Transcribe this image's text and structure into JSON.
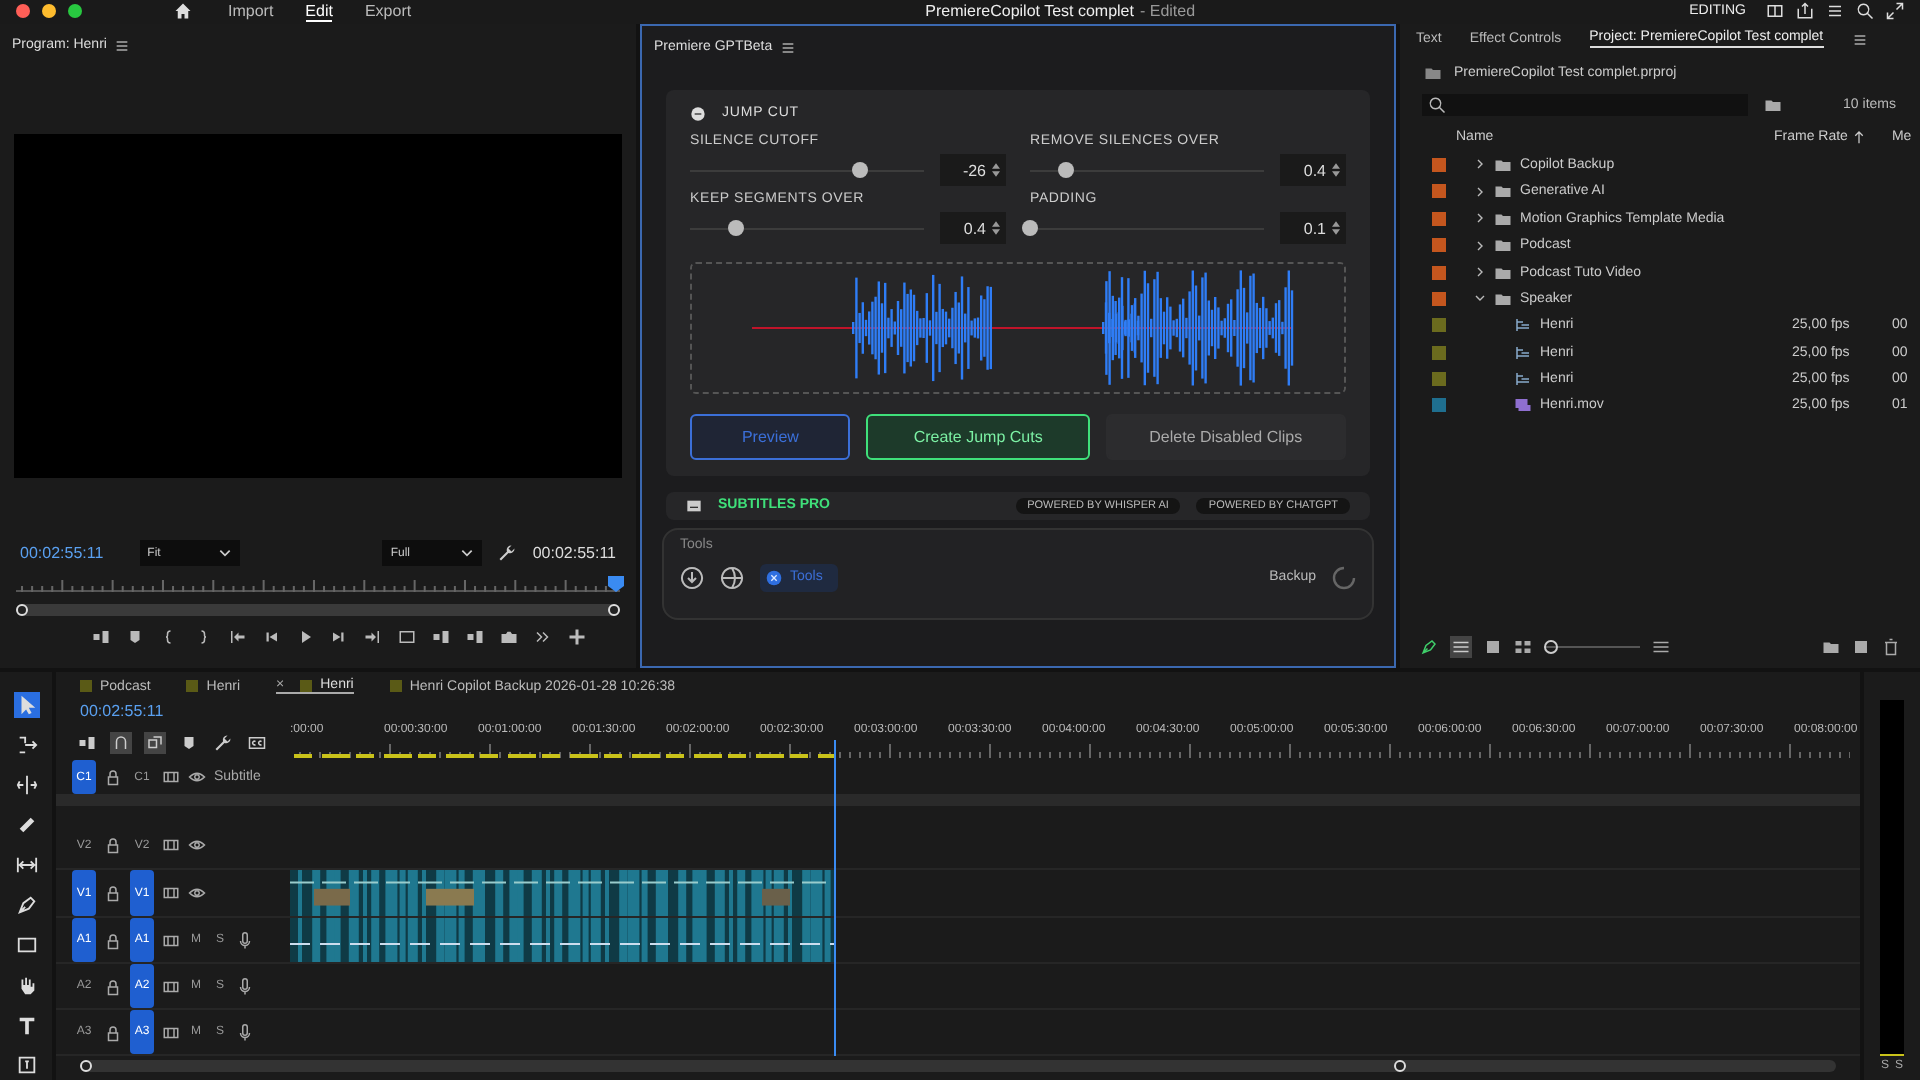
{
  "topbar": {
    "nav": [
      {
        "label": "Import",
        "selected": false
      },
      {
        "label": "Edit",
        "selected": true
      },
      {
        "label": "Export",
        "selected": false
      }
    ],
    "title": "PremiereCopilot Test complet",
    "status": "- Edited",
    "workspace": "EDITING"
  },
  "program": {
    "title": "Program: Henri",
    "timecode": "00:02:55:11",
    "zoom": "Fit",
    "quality": "Full",
    "duration": "00:02:55:11"
  },
  "plugin": {
    "title": "Premiere GPTBeta",
    "section": "JUMP CUT",
    "controls": [
      {
        "label": "SILENCE CUTOFF",
        "value": "-26",
        "level": 0.73
      },
      {
        "label": "REMOVE SILENCES OVER",
        "value": "0.4",
        "level": 0.15
      },
      {
        "label": "KEEP SEGMENTS OVER",
        "value": "0.4",
        "level": 0.2
      },
      {
        "label": "PADDING",
        "value": "0.1",
        "level": 0.0
      }
    ],
    "buttons": [
      {
        "label": "Preview",
        "kind": "secondary"
      },
      {
        "label": "Create Jump Cuts",
        "kind": "primary"
      },
      {
        "label": "Delete Disabled Clips",
        "kind": "ghost"
      }
    ],
    "next_section": {
      "title": "SUBTITLES PRO",
      "badges": [
        "POWERED BY WHISPER AI",
        "POWERED BY CHATGPT"
      ]
    },
    "tools": {
      "title": "Tools",
      "chip": "Tools",
      "backup": "Backup"
    }
  },
  "project": {
    "tabs": [
      {
        "label": "Text",
        "selected": false
      },
      {
        "label": "Effect Controls",
        "selected": false
      },
      {
        "label": "Project: PremiereCopilot Test complet",
        "selected": true
      }
    ],
    "file": "PremiereCopilot Test complet.prproj",
    "count": "10 items",
    "zoom": {
      "level": 0.0
    },
    "columns": [
      "Name",
      "Frame Rate",
      "Me"
    ],
    "items": [
      {
        "name": "Copilot Backup",
        "kind": "folder",
        "color": "#c4561e",
        "expanded": false
      },
      {
        "name": "Generative AI",
        "kind": "folder",
        "color": "#c4561e",
        "expanded": false
      },
      {
        "name": "Motion Graphics Template Media",
        "kind": "folder",
        "color": "#c4561e",
        "expanded": false
      },
      {
        "name": "Podcast",
        "kind": "folder",
        "color": "#c4561e",
        "expanded": false
      },
      {
        "name": "Podcast Tuto Video",
        "kind": "folder",
        "color": "#c4561e",
        "expanded": false
      },
      {
        "name": "Speaker",
        "kind": "folder",
        "color": "#c4561e",
        "expanded": true,
        "children": [
          {
            "name": "Henri",
            "kind": "sequence",
            "color": "#6b6b1e",
            "frame_rate": "25,00 fps",
            "media": "00"
          },
          {
            "name": "Henri",
            "kind": "sequence",
            "color": "#6b6b1e",
            "frame_rate": "25,00 fps",
            "media": "00"
          },
          {
            "name": "Henri",
            "kind": "sequence",
            "color": "#6b6b1e",
            "frame_rate": "25,00 fps",
            "media": "00"
          },
          {
            "name": "Henri.mov",
            "kind": "clip",
            "color": "#1f6f8f",
            "frame_rate": "25,00 fps",
            "media": "01"
          }
        ]
      }
    ]
  },
  "timeline": {
    "tabs": [
      {
        "label": "Podcast",
        "selected": false,
        "color": "#5a5a16"
      },
      {
        "label": "Henri",
        "selected": false,
        "color": "#5a5a16"
      },
      {
        "label": "Henri",
        "selected": true,
        "color": "#5a5a16",
        "close": "×"
      },
      {
        "label": "Henri Copilot Backup 2026-01-28 10:26:38",
        "selected": false,
        "color": "#5a5a16"
      }
    ],
    "timecode": "00:02:55:11",
    "ruler": [
      ":00:00",
      "00:00:30:00",
      "00:01:00:00",
      "00:01:30:00",
      "00:02:00:00",
      "00:02:30:00",
      "00:03:00:00",
      "00:03:30:00",
      "00:04:00:00",
      "00:04:30:00",
      "00:05:00:00",
      "00:05:30:00",
      "00:06:00:00",
      "00:06:30:00",
      "00:07:00:00",
      "00:07:30:00",
      "00:08:00:00"
    ],
    "tracks": [
      {
        "kind": "caption",
        "source": "C1",
        "target": "C1",
        "source_on": true,
        "target_on": false,
        "name": "Subtitle"
      },
      {
        "kind": "video",
        "source": "V2",
        "target": "V2",
        "source_on": false,
        "target_on": false
      },
      {
        "kind": "video",
        "source": "V1",
        "target": "V1",
        "source_on": true,
        "target_on": true,
        "clips": true
      },
      {
        "kind": "audio",
        "source": "A1",
        "target": "A1",
        "source_on": true,
        "target_on": true,
        "mute": "M",
        "solo": "S",
        "clips": true
      },
      {
        "kind": "audio",
        "source": "A2",
        "target": "A2",
        "source_on": false,
        "target_on": true,
        "mute": "M",
        "solo": "S"
      },
      {
        "kind": "audio",
        "source": "A3",
        "target": "A3",
        "source_on": false,
        "target_on": true,
        "mute": "M",
        "solo": "S"
      }
    ]
  },
  "meter": {
    "labels": [
      "S",
      "S"
    ]
  }
}
